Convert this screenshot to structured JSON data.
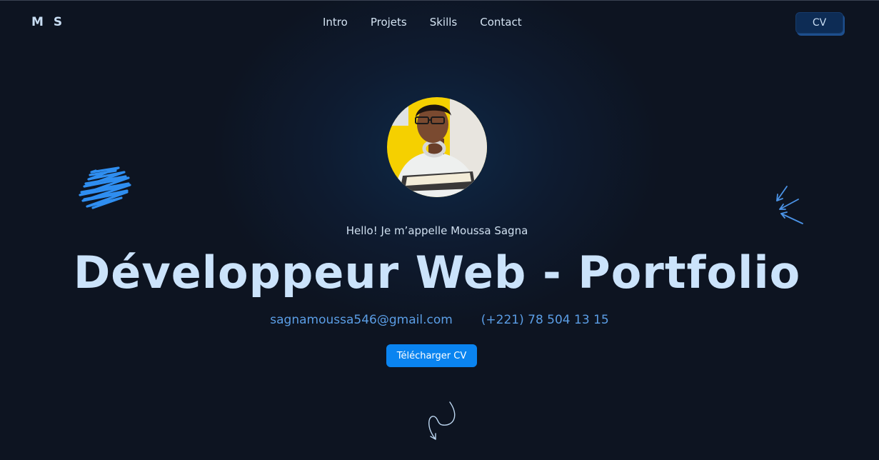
{
  "header": {
    "logo": "M S",
    "nav": [
      "Intro",
      "Projets",
      "Skills",
      "Contact"
    ],
    "cv_button": "CV"
  },
  "hero": {
    "greeting": "Hello! Je m’appelle Moussa Sagna",
    "headline": "Développeur Web - Portfolio",
    "email": "sagnamoussa546@gmail.com",
    "phone": "(+221) 78 504 13 15",
    "download_button": "Télécharger CV"
  },
  "colors": {
    "background": "#0d1421",
    "accent": "#0a84f0",
    "headline": "#cbe3fb",
    "link": "#5b9ee6",
    "avatar_background": "#f5d000"
  },
  "icons": {
    "scribble": "scribble-icon",
    "arrows": "arrows-icon",
    "scroll_down": "scroll-arrow-icon"
  }
}
